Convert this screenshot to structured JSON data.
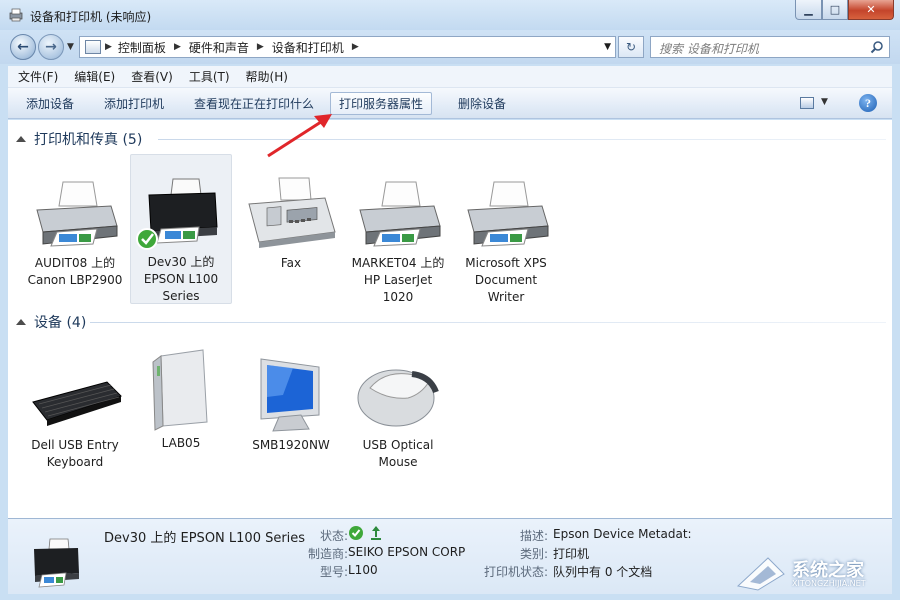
{
  "window": {
    "title": "设备和打印机 (未响应)"
  },
  "nav": {
    "breadcrumbs": [
      "控制面板",
      "硬件和声音",
      "设备和打印机"
    ],
    "search_placeholder": "搜索 设备和打印机"
  },
  "menu": [
    "文件(F)",
    "编辑(E)",
    "查看(V)",
    "工具(T)",
    "帮助(H)"
  ],
  "toolbar": {
    "add_device": "添加设备",
    "add_printer": "添加打印机",
    "see_printing": "查看现在正在打印什么",
    "print_server": "打印服务器属性",
    "remove_device": "删除设备"
  },
  "groups": {
    "printers": {
      "title": "打印机和传真 (5)",
      "items": [
        {
          "label": "AUDIT08 上的\nCanon LBP2900",
          "icon": "laser-printer-icon"
        },
        {
          "label": "Dev30 上的\nEPSON L100\nSeries",
          "icon": "inkjet-printer-icon",
          "default": true
        },
        {
          "label": "Fax",
          "icon": "fax-icon"
        },
        {
          "label": "MARKET04 上的\nHP LaserJet\n1020",
          "icon": "laser-printer-icon"
        },
        {
          "label": "Microsoft XPS\nDocument\nWriter",
          "icon": "laser-printer-icon"
        }
      ]
    },
    "devices": {
      "title": "设备 (4)",
      "items": [
        {
          "label": "Dell USB Entry\nKeyboard",
          "icon": "keyboard-icon"
        },
        {
          "label": "LAB05",
          "icon": "computer-tower-icon"
        },
        {
          "label": "SMB1920NW",
          "icon": "monitor-icon"
        },
        {
          "label": "USB Optical\nMouse",
          "icon": "mouse-icon"
        }
      ]
    }
  },
  "details": {
    "title": "Dev30 上的 EPSON L100 Series",
    "status_label": "状态:",
    "maker_label": "制造商:",
    "maker": "SEIKO EPSON CORP",
    "model_label": "型号:",
    "model": "L100",
    "desc_label": "描述:",
    "desc": "Epson Device Metadat:",
    "category_label": "类别:",
    "category": "打印机",
    "printer_status_label": "打印机状态:",
    "printer_status": "队列中有 0 个文档"
  },
  "watermark": {
    "text": "系统之家",
    "url": "XITONGZHIJIA.NET"
  },
  "colors": {
    "accent": "#1e395b",
    "selected_bg": "#ecf0f5",
    "arrow": "#e0262a"
  }
}
